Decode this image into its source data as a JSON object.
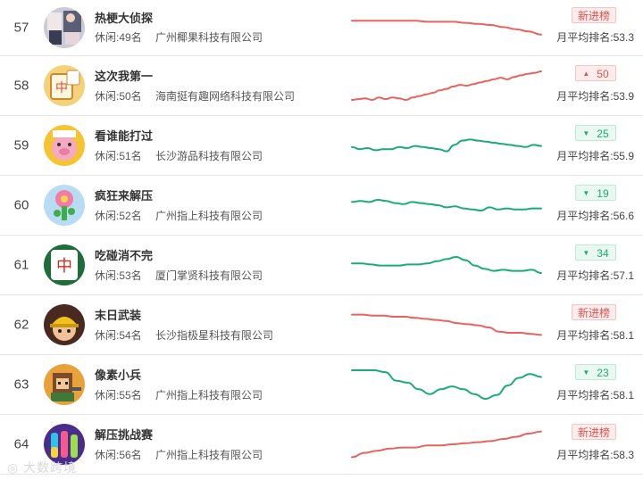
{
  "colors": {
    "red": "#e8635f",
    "green": "#1aab7d"
  },
  "rows": [
    {
      "rank": "57",
      "name": "热梗大侦探",
      "category": "休闲:49名",
      "developer": "广州椰果科技有限公司",
      "badge_type": "new",
      "badge_text": "新进榜",
      "badge_arrow": "",
      "avg": "月平均排名:53.3",
      "icon_name": "photo-collage-icon",
      "trend_color": "red",
      "trend": [
        50,
        50,
        50,
        50,
        50,
        50,
        51,
        51,
        51,
        52,
        53,
        54,
        56,
        58,
        60,
        63
      ]
    },
    {
      "rank": "58",
      "name": "这次我第一",
      "category": "休闲:50名",
      "developer": "海南挺有趣网络科技有限公司",
      "badge_type": "up",
      "badge_text": "50",
      "badge_arrow": "▲",
      "avg": "月平均排名:53.9",
      "icon_name": "mahjong-tile-icon",
      "trend_color": "red",
      "trend": [
        104,
        103,
        102,
        104,
        101,
        103,
        101,
        102,
        104,
        101,
        99,
        97,
        95,
        92,
        90,
        87,
        85,
        86,
        84,
        82,
        80,
        78,
        76,
        78,
        75,
        73,
        71,
        70,
        68
      ]
    },
    {
      "rank": "59",
      "name": "看谁能打过",
      "category": "休闲:51名",
      "developer": "长沙游品科技有限公司",
      "badge_type": "down",
      "badge_text": "25",
      "badge_arrow": "▼",
      "avg": "月平均排名:55.9",
      "icon_name": "cartoon-pig-icon",
      "trend_color": "green",
      "trend": [
        78,
        80,
        79,
        81,
        80,
        80,
        78,
        79,
        77,
        78,
        79,
        80,
        82,
        76,
        72,
        71,
        72,
        73,
        74,
        75,
        76,
        77,
        78,
        76,
        77
      ]
    },
    {
      "rank": "60",
      "name": "疯狂来解压",
      "category": "休闲:52名",
      "developer": "广州指上科技有限公司",
      "badge_type": "down",
      "badge_text": "19",
      "badge_arrow": "▼",
      "avg": "月平均排名:56.6",
      "icon_name": "flower-cactus-icon",
      "trend_color": "green",
      "trend": [
        98,
        97,
        98,
        96,
        97,
        99,
        100,
        98,
        99,
        100,
        101,
        103,
        102,
        104,
        105,
        106,
        103,
        105,
        104,
        105,
        105,
        104,
        104
      ]
    },
    {
      "rank": "61",
      "name": "吃碰消不完",
      "category": "休闲:53名",
      "developer": "厦门掌贤科技有限公司",
      "badge_type": "down",
      "badge_text": "34",
      "badge_arrow": "▼",
      "avg": "月平均排名:57.1",
      "icon_name": "mahjong-zhong-icon",
      "trend_color": "green",
      "trend": [
        110,
        110,
        111,
        112,
        112,
        112,
        111,
        111,
        110,
        108,
        106,
        104,
        107,
        112,
        115,
        117,
        116,
        117,
        117,
        116,
        119
      ]
    },
    {
      "rank": "62",
      "name": "末日武装",
      "category": "休闲:54名",
      "developer": "长沙指极星科技有限公司",
      "badge_type": "new",
      "badge_text": "新进榜",
      "badge_arrow": "",
      "avg": "月平均排名:58.1",
      "icon_name": "soldier-helmet-icon",
      "trend_color": "red",
      "trend": [
        110,
        110,
        111,
        111,
        112,
        112,
        113,
        114,
        115,
        116,
        118,
        119,
        120,
        122,
        126,
        127,
        127,
        128,
        129
      ]
    },
    {
      "rank": "63",
      "name": "像素小兵",
      "category": "休闲:55名",
      "developer": "广州指上科技有限公司",
      "badge_type": "down",
      "badge_text": "23",
      "badge_arrow": "▼",
      "avg": "月平均排名:58.1",
      "icon_name": "pixel-soldier-icon",
      "trend_color": "green",
      "trend": [
        100,
        100,
        100,
        102,
        111,
        113,
        120,
        125,
        120,
        117,
        120,
        125,
        130,
        126,
        116,
        108,
        104,
        107
      ]
    },
    {
      "rank": "64",
      "name": "解压挑战赛",
      "category": "休闲:56名",
      "developer": "广州指上科技有限公司",
      "badge_type": "new",
      "badge_text": "新进榜",
      "badge_arrow": "",
      "avg": "月平均排名:58.3",
      "icon_name": "color-bottles-icon",
      "trend_color": "red",
      "trend": [
        130,
        126,
        124,
        122,
        121,
        121,
        119,
        119,
        118,
        117,
        116,
        115,
        113,
        111,
        108,
        106
      ]
    }
  ],
  "watermark": "大数跨境"
}
